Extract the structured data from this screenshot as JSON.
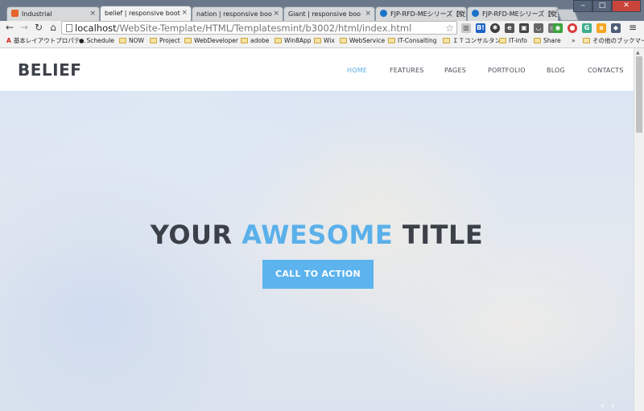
{
  "browser": {
    "tabs": [
      {
        "title": "Industrial",
        "icon": "orange-blog-icon",
        "active": false
      },
      {
        "title": "belief | responsive boot",
        "icon": "page-icon",
        "active": true
      },
      {
        "title": "nation | responsive boo",
        "icon": "page-icon",
        "active": false
      },
      {
        "title": "Giant | responsive boo",
        "icon": "page-icon",
        "active": false
      },
      {
        "title": "FJP-RFD-MEシリーズ【従来",
        "icon": "blue-globe-icon",
        "active": false
      },
      {
        "title": "FJP-RFD-MEシリーズ【従来",
        "icon": "blue-globe-icon",
        "active": false
      }
    ],
    "tab_close": "×",
    "window_buttons": {
      "minimize": "‒",
      "maximize": "□",
      "close": "✕"
    },
    "url": {
      "host": "localhost",
      "path": "/WebSite-Template/HTML/Templatesmint/b3002/html/index.html"
    },
    "bookmarks": [
      {
        "label": "基本レイアウトプロパテ…",
        "icon": "adobe-icon"
      },
      {
        "label": "Schedule",
        "icon": "apple-icon"
      },
      {
        "label": "NOW",
        "icon": "folder-icon"
      },
      {
        "label": "Project",
        "icon": "folder-icon"
      },
      {
        "label": "WebDeveloper",
        "icon": "folder-icon"
      },
      {
        "label": "adobe",
        "icon": "folder-icon"
      },
      {
        "label": "Win8App",
        "icon": "folder-icon"
      },
      {
        "label": "Wix",
        "icon": "folder-icon"
      },
      {
        "label": "WebService",
        "icon": "folder-icon"
      },
      {
        "label": "IT-Consalting",
        "icon": "folder-icon"
      },
      {
        "label": "ＩＴコンサルタント",
        "icon": "folder-icon"
      },
      {
        "label": "IT-info",
        "icon": "folder-icon"
      },
      {
        "label": "Share",
        "icon": "folder-icon"
      }
    ],
    "bookmarks_overflow": "»",
    "other_bookmarks": "その他のブックマーク"
  },
  "site": {
    "logo": "BELIEF",
    "nav": [
      "HOME",
      "FEATURES",
      "PAGES",
      "PORTFOLIO",
      "BLOG",
      "CONTACTS"
    ],
    "active_nav": "HOME",
    "hero": {
      "title_part1": "YOUR ",
      "title_accent": "AWESOME",
      "title_part2": " TITLE",
      "cta": "CALL TO ACTION"
    },
    "slider_prev": "‹",
    "slider_next": "›"
  },
  "colors": {
    "accent": "#5ab0ea",
    "text_dark": "#3c4048",
    "cta_bg": "#5cb3ee"
  }
}
